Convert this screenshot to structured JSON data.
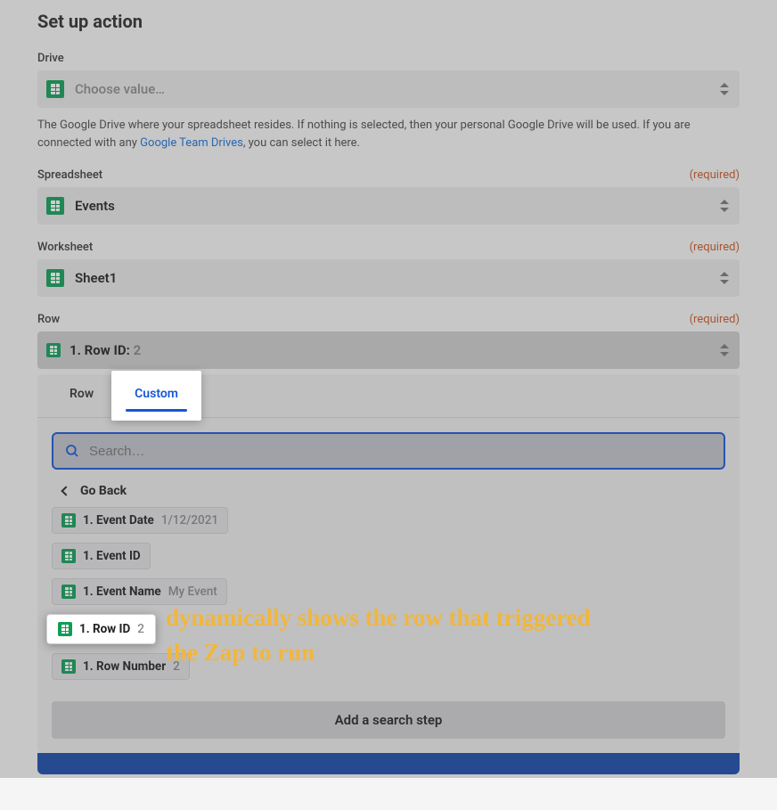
{
  "page": {
    "title": "Set up action"
  },
  "fields": {
    "drive": {
      "label": "Drive",
      "placeholder": "Choose value…",
      "help_before": "The Google Drive where your spreadsheet resides. If nothing is selected, then your personal Google Drive will be used. If you are connected with any ",
      "help_link": "Google Team Drives",
      "help_after": ", you can select it here."
    },
    "spreadsheet": {
      "label": "Spreadsheet",
      "value": "Events",
      "required": "(required)"
    },
    "worksheet": {
      "label": "Worksheet",
      "value": "Sheet1",
      "required": "(required)"
    },
    "row": {
      "label": "Row",
      "prefix": "1. Row ID: ",
      "value": "2",
      "required": "(required)"
    }
  },
  "dropdown": {
    "tabs": {
      "row": "Row",
      "custom": "Custom"
    },
    "search_placeholder": "Search…",
    "go_back": "Go Back",
    "options": [
      {
        "label": "1. Event Date",
        "value": "1/12/2021"
      },
      {
        "label": "1. Event ID",
        "value": ""
      },
      {
        "label": "1. Event Name",
        "value": "My Event"
      },
      {
        "label": "1. Row ID",
        "value": "2"
      },
      {
        "label": "1. Row Number",
        "value": "2"
      }
    ],
    "add_search": "Add a search step"
  },
  "annotation": "dynamically shows the row that triggered the Zap to run"
}
